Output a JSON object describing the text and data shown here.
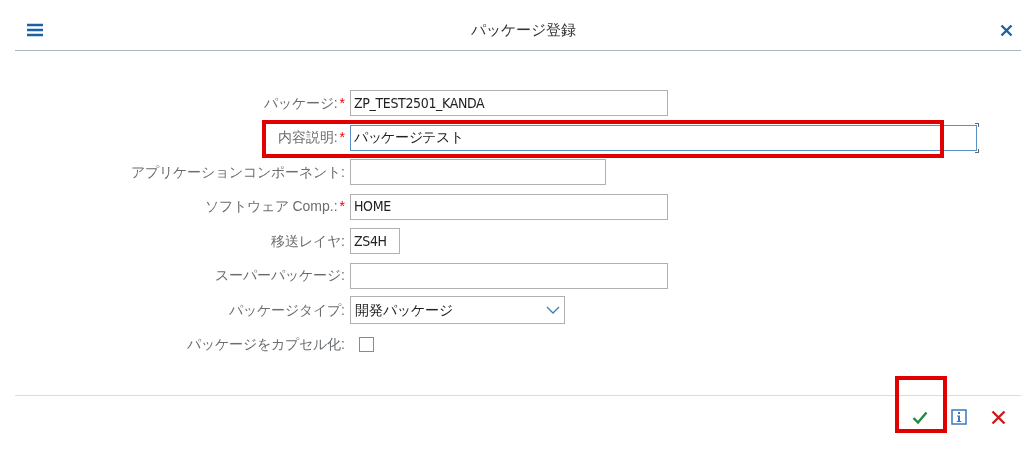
{
  "dialog": {
    "title": "パッケージ登録"
  },
  "fields": [
    {
      "kind": "text",
      "label": "パッケージ:",
      "required": true,
      "value": "ZP_TEST2501_KANDA",
      "highlighted": false
    },
    {
      "kind": "textarea",
      "label": "内容説明:",
      "required": true,
      "value": "パッケージテスト",
      "highlighted": true
    },
    {
      "kind": "text",
      "label": "アプリケーションコンポーネント:",
      "required": false,
      "highlighted": false
    },
    {
      "kind": "text",
      "label": "ソフトウェア Comp.:",
      "required": true,
      "value": "HOME",
      "highlighted": false
    },
    {
      "kind": "text",
      "label": "移送レイヤ:",
      "required": false,
      "value": "ZS4H",
      "highlighted": false
    },
    {
      "kind": "text",
      "label": "スーパーパッケージ:",
      "required": false,
      "highlighted": false
    },
    {
      "kind": "select",
      "label": "パッケージタイプ:",
      "required": false,
      "value": "開発パッケージ",
      "highlighted": false
    },
    {
      "kind": "checkbox",
      "label": "パッケージをカプセル化:",
      "required": false,
      "checked": false,
      "highlighted": false
    }
  ],
  "required_mark": "*",
  "footer_buttons": [
    {
      "kind": "confirm",
      "highlighted": true
    },
    {
      "kind": "info",
      "highlighted": false
    },
    {
      "kind": "cancel",
      "highlighted": false
    }
  ]
}
